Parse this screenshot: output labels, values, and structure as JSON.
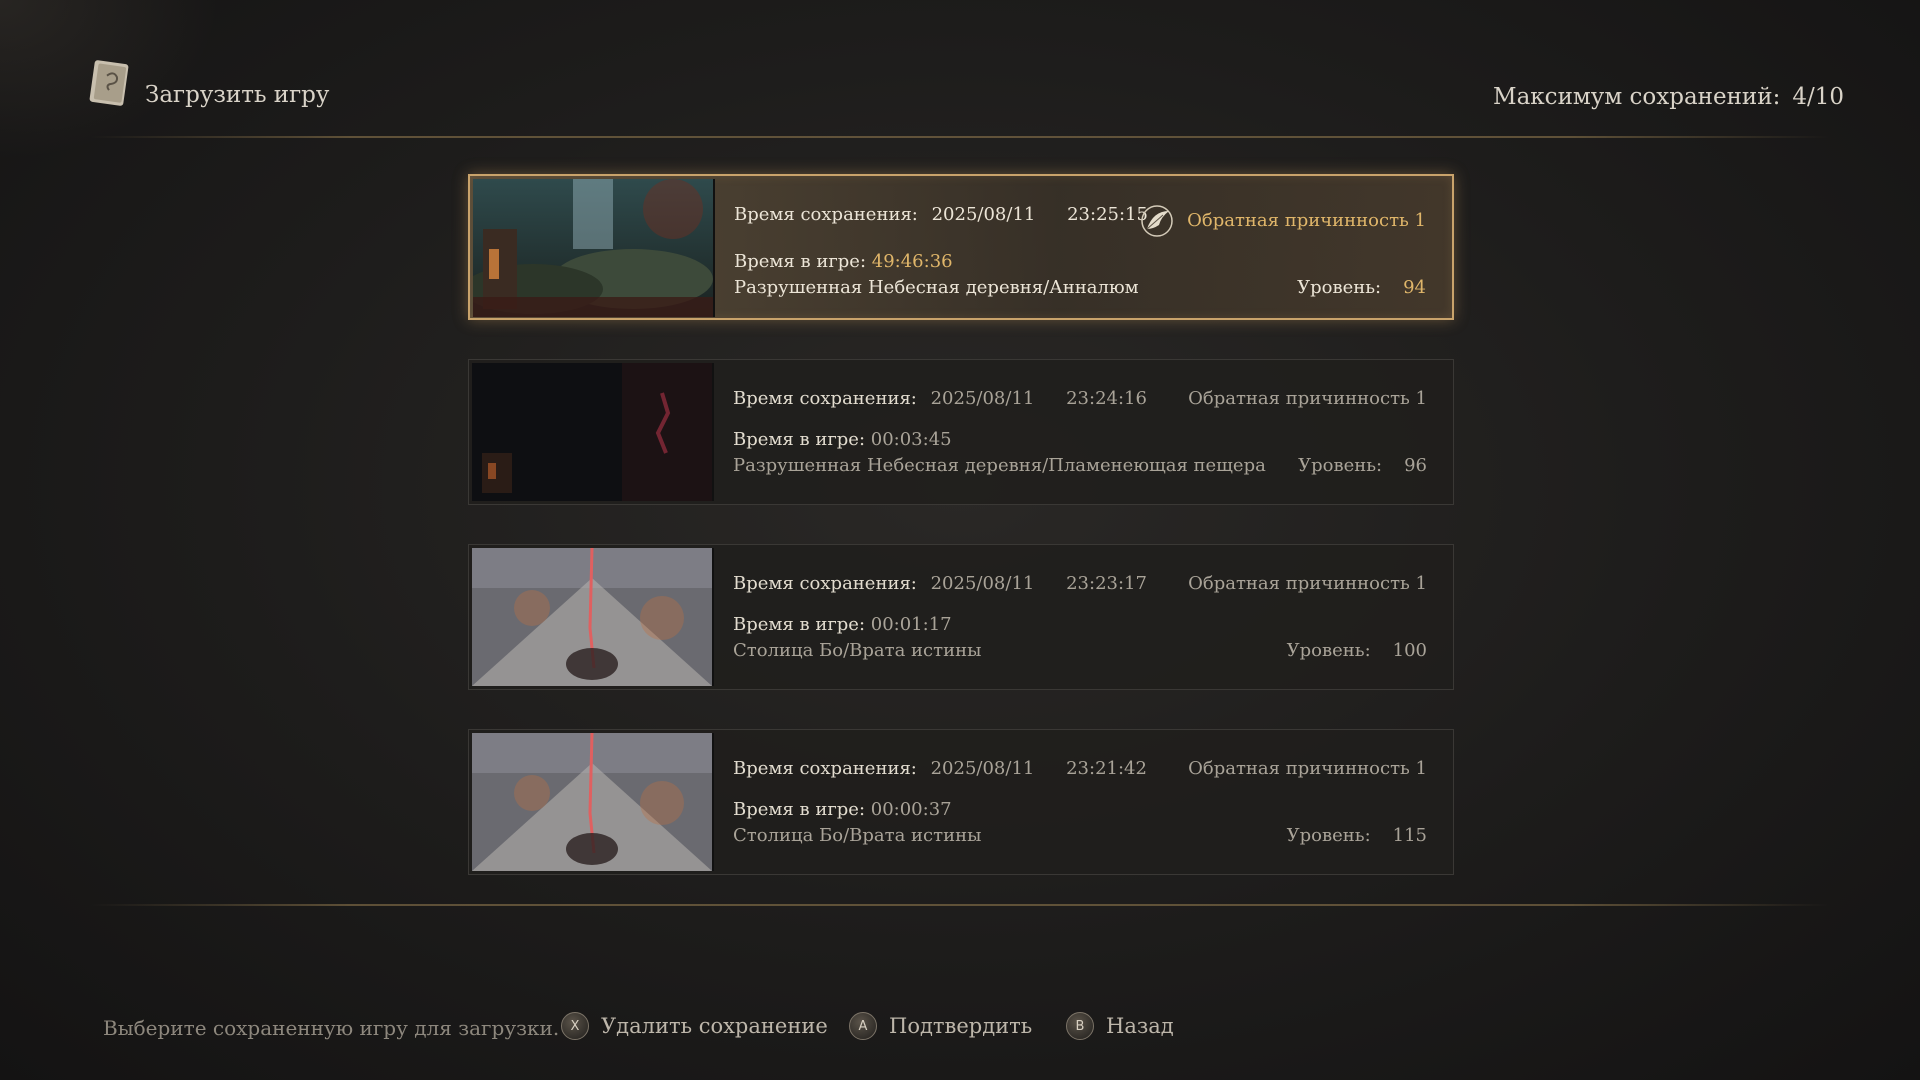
{
  "header": {
    "title": "Загрузить игру",
    "max_saves_label": "Максимум сохранений:",
    "max_saves_value": "4/10"
  },
  "saves": [
    {
      "save_label": "Время сохранения:",
      "date": "2025/08/11",
      "time": "23:25:15",
      "cycle": "Обратная причинность 1",
      "playtime_label": "Время в игре:",
      "playtime": "49:46:36",
      "location": "Разрушенная Небесная деревня/Анналюм",
      "level_label": "Уровень:",
      "level": "94",
      "selected": true
    },
    {
      "save_label": "Время сохранения:",
      "date": "2025/08/11",
      "time": "23:24:16",
      "cycle": "Обратная причинность 1",
      "playtime_label": "Время в игре:",
      "playtime": "00:03:45",
      "location": "Разрушенная Небесная деревня/Пламенеющая пещера",
      "level_label": "Уровень:",
      "level": "96",
      "selected": false
    },
    {
      "save_label": "Время сохранения:",
      "date": "2025/08/11",
      "time": "23:23:17",
      "cycle": "Обратная причинность 1",
      "playtime_label": "Время в игре:",
      "playtime": "00:01:17",
      "location": "Столица Бо/Врата истины",
      "level_label": "Уровень:",
      "level": "100",
      "selected": false
    },
    {
      "save_label": "Время сохранения:",
      "date": "2025/08/11",
      "time": "23:21:42",
      "cycle": "Обратная причинность 1",
      "playtime_label": "Время в игре:",
      "playtime": "00:00:37",
      "location": "Столица Бо/Врата истины",
      "level_label": "Уровень:",
      "level": "115",
      "selected": false
    }
  ],
  "footer": {
    "hint": "Выберите сохраненную игру для загрузки.",
    "delete": {
      "glyph": "X",
      "label": "Удалить сохранение"
    },
    "confirm": {
      "glyph": "A",
      "label": "Подтвердить"
    },
    "back": {
      "glyph": "B",
      "label": "Назад"
    }
  },
  "colors": {
    "accent_gold": "#e0b66a",
    "selected_border": "#c9a36b"
  },
  "icons": {
    "header": "journal-book-icon",
    "cycle": "feather-cycle-icon"
  }
}
